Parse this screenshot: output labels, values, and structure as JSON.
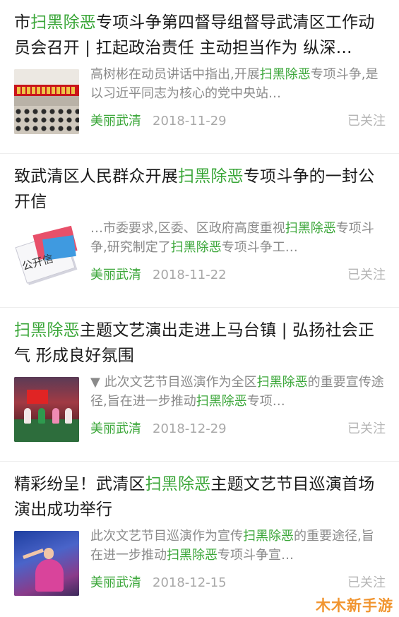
{
  "results": [
    {
      "title_parts": [
        "市",
        "扫黑除恶",
        "专项斗争第四督导组督导武清区工作动员会召开 | 扛起政治责任 主动担当作为 纵深…"
      ],
      "digest_parts": [
        "高树彬在动员讲话中指出,开展",
        "扫黑除恶",
        "专项斗争,是以习近平同志为核心的党中央站…"
      ],
      "source": "美丽武清",
      "date": "2018-11-29",
      "follow_status": "已关注",
      "thumb_icon": "meeting-photo"
    },
    {
      "title_parts": [
        "致武清区人民群众开展",
        "扫黑除恶",
        "专项斗争的一封公开信"
      ],
      "digest_parts": [
        "…市委要求,区委、区政府高度重视",
        "扫黑除恶",
        "专项斗争,研究制定了",
        "扫黑除恶",
        "专项斗争工…"
      ],
      "source": "美丽武清",
      "date": "2018-11-22",
      "follow_status": "已关注",
      "thumb_icon": "open-letter-image",
      "thumb_text": "公开信"
    },
    {
      "title_parts": [
        "扫黑除恶",
        "主题文艺演出走进上马台镇 | 弘扬社会正气 形成良好氛围"
      ],
      "digest_parts": [
        "▼ 此次文艺节目巡演作为全区",
        "扫黑除恶",
        "的重要宣传途径,旨在进一步推动",
        "扫黑除恶",
        "专项…"
      ],
      "source": "美丽武清",
      "date": "2018-12-29",
      "follow_status": "已关注",
      "thumb_icon": "stage-performance-photo"
    },
    {
      "title_parts": [
        "精彩纷呈！武清区",
        "扫黑除恶",
        "主题文艺节目巡演首场演出成功举行"
      ],
      "digest_parts": [
        "此次文艺节目巡演作为宣传",
        "扫黑除恶",
        "的重要途径,旨在进一步推动",
        "扫黑除恶",
        "专项斗争宣…"
      ],
      "source": "美丽武清",
      "date": "2018-12-15",
      "follow_status": "已关注",
      "thumb_icon": "dancer-photo"
    }
  ],
  "watermark": "木木新手游",
  "colors": {
    "highlight": "#3aa638",
    "title": "#1a1a1a",
    "digest": "#8a8a8a",
    "date": "#a8a8a8",
    "follow": "#b4b4b4",
    "watermark": "#f08a1a"
  }
}
